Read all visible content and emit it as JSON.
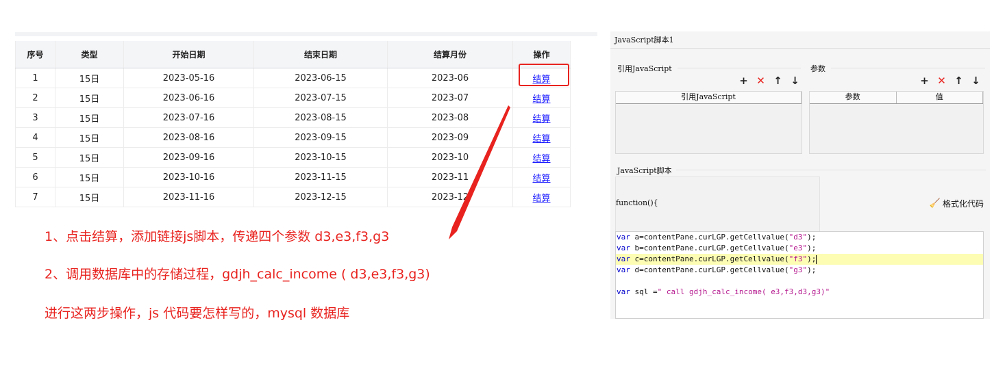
{
  "table": {
    "headers": [
      "序号",
      "类型",
      "开始日期",
      "结束日期",
      "结算月份",
      "操作"
    ],
    "rows": [
      {
        "no": "1",
        "type": "15日",
        "start": "2023-05-16",
        "end": "2023-06-15",
        "month": "2023-06",
        "action": "结算"
      },
      {
        "no": "2",
        "type": "15日",
        "start": "2023-06-16",
        "end": "2023-07-15",
        "month": "2023-07",
        "action": "结算"
      },
      {
        "no": "3",
        "type": "15日",
        "start": "2023-07-16",
        "end": "2023-08-15",
        "month": "2023-08",
        "action": "结算"
      },
      {
        "no": "4",
        "type": "15日",
        "start": "2023-08-16",
        "end": "2023-09-15",
        "month": "2023-09",
        "action": "结算"
      },
      {
        "no": "5",
        "type": "15日",
        "start": "2023-09-16",
        "end": "2023-10-15",
        "month": "2023-10",
        "action": "结算"
      },
      {
        "no": "6",
        "type": "15日",
        "start": "2023-10-16",
        "end": "2023-11-15",
        "month": "2023-11",
        "action": "结算"
      },
      {
        "no": "7",
        "type": "15日",
        "start": "2023-11-16",
        "end": "2023-12-15",
        "month": "2023-12",
        "action": "结算"
      }
    ]
  },
  "notes": {
    "line1": "1、点击结算，添加链接js脚本，传递四个参数 d3,e3,f3,g3",
    "line2": "2、调用数据库中的存储过程，gdjh_calc_income ( d3,e3,f3,g3)",
    "line3": "进行这两步操作，js 代码要怎样写的，mysql 数据库"
  },
  "colors": {
    "annotation": "#e8231f",
    "link": "#1a1aff",
    "keyword": "#0000cc",
    "string": "#b5188f",
    "active_line": "#fdfdb4"
  },
  "panel": {
    "title": "JavaScript脚本1",
    "ref_section": {
      "label": "引用JavaScript",
      "column": "引用JavaScript",
      "toolbar_icons": [
        "plus-icon",
        "delete-icon",
        "arrow-up-icon",
        "arrow-down-icon"
      ]
    },
    "param_section": {
      "label": "参数",
      "columns": [
        "参数",
        "值"
      ],
      "toolbar_icons": [
        "plus-icon",
        "delete-icon",
        "arrow-up-icon",
        "arrow-down-icon"
      ]
    },
    "script_section": {
      "label": "JavaScript脚本",
      "function_header": "function(){",
      "format_button": "格式化代码",
      "code": [
        {
          "kw": "var",
          "text": " a=contentPane.curLGP.getCellvalue(",
          "str": "\"d3\"",
          "tail": ");"
        },
        {
          "kw": "var",
          "text": " b=contentPane.curLGP.getCellvalue(",
          "str": "\"e3\"",
          "tail": ");"
        },
        {
          "kw": "var",
          "text": " c=contentPane.curLGP.getCellvalue(",
          "str": "\"f3\"",
          "tail": ");"
        },
        {
          "kw": "var",
          "text": " d=contentPane.curLGP.getCellvalue(",
          "str": "\"g3\"",
          "tail": ");"
        },
        {
          "kw": "",
          "text": "",
          "str": "",
          "tail": ""
        },
        {
          "kw": "var",
          "text": " sql =",
          "str": "\" call gdjh_calc_income( e3,f3,d3,g3)\"",
          "tail": ""
        }
      ]
    }
  }
}
